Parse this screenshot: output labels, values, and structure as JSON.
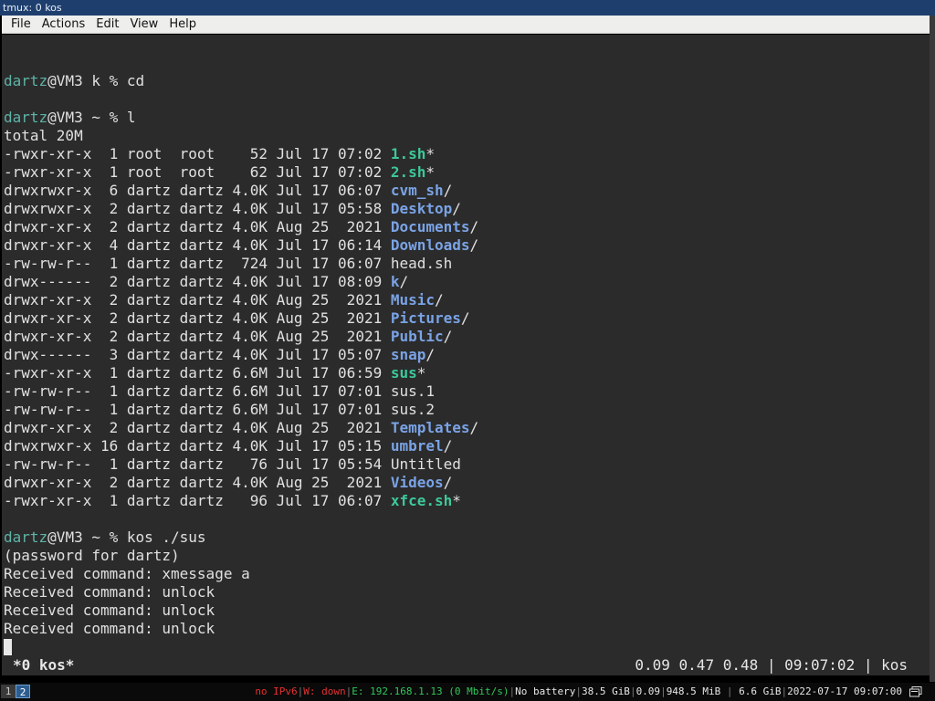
{
  "window": {
    "title": "tmux: 0 kos"
  },
  "menu": {
    "items": [
      "File",
      "Actions",
      "Edit",
      "View",
      "Help"
    ]
  },
  "terminal": {
    "lines": [
      [
        [
          "dartz",
          "user"
        ],
        [
          "@VM3 k % cd",
          ""
        ]
      ],
      [],
      [
        [
          "dartz",
          "user"
        ],
        [
          "@VM3 ~ % l",
          ""
        ]
      ],
      [
        [
          "total 20M",
          ""
        ]
      ],
      [
        [
          "-rwxr-xr-x  1 root  root    52 Jul 17 07:02 ",
          ""
        ],
        [
          "1.sh",
          "exe"
        ],
        [
          "*",
          ""
        ]
      ],
      [
        [
          "-rwxr-xr-x  1 root  root    62 Jul 17 07:02 ",
          ""
        ],
        [
          "2.sh",
          "exe"
        ],
        [
          "*",
          ""
        ]
      ],
      [
        [
          "drwxrwxr-x  6 dartz dartz 4.0K Jul 17 06:07 ",
          ""
        ],
        [
          "cvm_sh",
          "dir"
        ],
        [
          "/",
          ""
        ]
      ],
      [
        [
          "drwxrwxr-x  2 dartz dartz 4.0K Jul 17 05:58 ",
          ""
        ],
        [
          "Desktop",
          "dir"
        ],
        [
          "/",
          ""
        ]
      ],
      [
        [
          "drwxr-xr-x  2 dartz dartz 4.0K Aug 25  2021 ",
          ""
        ],
        [
          "Documents",
          "dir"
        ],
        [
          "/",
          ""
        ]
      ],
      [
        [
          "drwxr-xr-x  4 dartz dartz 4.0K Jul 17 06:14 ",
          ""
        ],
        [
          "Downloads",
          "dir"
        ],
        [
          "/",
          ""
        ]
      ],
      [
        [
          "-rw-rw-r--  1 dartz dartz  724 Jul 17 06:07 head.sh",
          ""
        ]
      ],
      [
        [
          "drwx------  2 dartz dartz 4.0K Jul 17 08:09 ",
          ""
        ],
        [
          "k",
          "dir"
        ],
        [
          "/",
          ""
        ]
      ],
      [
        [
          "drwxr-xr-x  2 dartz dartz 4.0K Aug 25  2021 ",
          ""
        ],
        [
          "Music",
          "dir"
        ],
        [
          "/",
          ""
        ]
      ],
      [
        [
          "drwxr-xr-x  2 dartz dartz 4.0K Aug 25  2021 ",
          ""
        ],
        [
          "Pictures",
          "dir"
        ],
        [
          "/",
          ""
        ]
      ],
      [
        [
          "drwxr-xr-x  2 dartz dartz 4.0K Aug 25  2021 ",
          ""
        ],
        [
          "Public",
          "dir"
        ],
        [
          "/",
          ""
        ]
      ],
      [
        [
          "drwx------  3 dartz dartz 4.0K Jul 17 05:07 ",
          ""
        ],
        [
          "snap",
          "dir"
        ],
        [
          "/",
          ""
        ]
      ],
      [
        [
          "-rwxr-xr-x  1 dartz dartz 6.6M Jul 17 06:59 ",
          ""
        ],
        [
          "sus",
          "exe"
        ],
        [
          "*",
          ""
        ]
      ],
      [
        [
          "-rw-rw-r--  1 dartz dartz 6.6M Jul 17 07:01 sus.1",
          ""
        ]
      ],
      [
        [
          "-rw-rw-r--  1 dartz dartz 6.6M Jul 17 07:01 sus.2",
          ""
        ]
      ],
      [
        [
          "drwxr-xr-x  2 dartz dartz 4.0K Aug 25  2021 ",
          ""
        ],
        [
          "Templates",
          "dir"
        ],
        [
          "/",
          ""
        ]
      ],
      [
        [
          "drwxrwxr-x 16 dartz dartz 4.0K Jul 17 05:15 ",
          ""
        ],
        [
          "umbrel",
          "dir"
        ],
        [
          "/",
          ""
        ]
      ],
      [
        [
          "-rw-rw-r--  1 dartz dartz   76 Jul 17 05:54 Untitled",
          ""
        ]
      ],
      [
        [
          "drwxr-xr-x  2 dartz dartz 4.0K Aug 25  2021 ",
          ""
        ],
        [
          "Videos",
          "dir"
        ],
        [
          "/",
          ""
        ]
      ],
      [
        [
          "-rwxr-xr-x  1 dartz dartz   96 Jul 17 06:07 ",
          ""
        ],
        [
          "xfce.sh",
          "exe"
        ],
        [
          "*",
          ""
        ]
      ],
      [],
      [
        [
          "dartz",
          "user"
        ],
        [
          "@VM3 ~ % kos ./sus",
          ""
        ]
      ],
      [
        [
          "(password for dartz)",
          ""
        ]
      ],
      [
        [
          "Received command: xmessage a",
          ""
        ]
      ],
      [
        [
          "Received command: unlock",
          ""
        ]
      ],
      [
        [
          "Received command: unlock",
          ""
        ]
      ],
      [
        [
          "Received command: unlock",
          ""
        ]
      ],
      [
        [
          "__CURSOR__",
          "cursor"
        ]
      ]
    ]
  },
  "tmux_status": {
    "window": "*0 kos*",
    "right": "0.09 0.47 0.48 | 09:07:02 | kos"
  },
  "bottom_bar": {
    "workspaces": [
      "1",
      "2"
    ],
    "ipv6": "no IPv6",
    "wifi": "W: down",
    "ethernet": "E: 192.168.1.13 (0 Mbit/s)",
    "battery": "No battery",
    "disk": "38.5 GiB",
    "load": "0.09",
    "memory": "948.5 MiB",
    "memory_total": "6.6 GiB",
    "datetime": "2022-07-17 09:07:00",
    "colors": {
      "red": "#e53030",
      "green": "#2fc85a"
    }
  }
}
